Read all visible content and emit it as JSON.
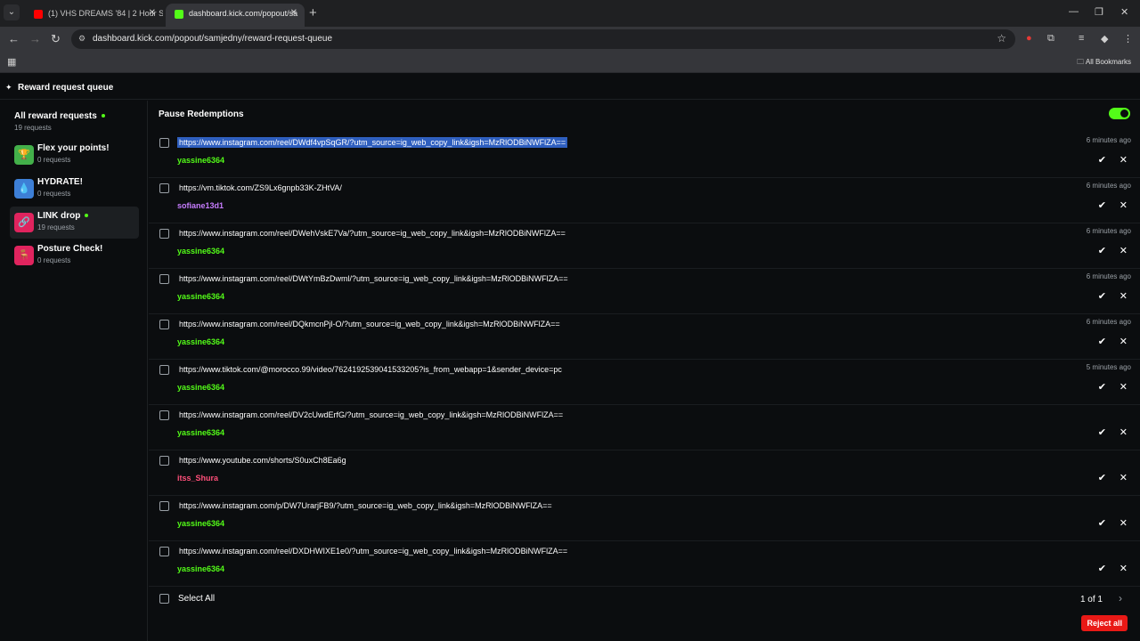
{
  "browser": {
    "tabs": [
      {
        "title": "(1) VHS DREAMS '84 | 2 Hour Sy",
        "active": false
      },
      {
        "title": "dashboard.kick.com/popout/sa",
        "active": true
      }
    ],
    "url": "dashboard.kick.com/popout/samjedny/reward-request-queue",
    "all_bookmarks": "All Bookmarks"
  },
  "page": {
    "title": "Reward request queue"
  },
  "sidebar": {
    "all": {
      "label": "All reward requests",
      "count": "19 requests"
    },
    "items": [
      {
        "label": "Flex your points!",
        "count": "0 requests",
        "color": "#43b04a",
        "icon": "trophy-icon",
        "glyph": "🏆"
      },
      {
        "label": "HYDRATE!",
        "count": "0 requests",
        "color": "#3d7fd6",
        "icon": "water-icon",
        "glyph": "💧"
      },
      {
        "label": "LINK drop",
        "count": "19 requests",
        "color": "#e0245e",
        "icon": "link-icon",
        "glyph": "🔗"
      },
      {
        "label": "Posture Check!",
        "count": "0 requests",
        "color": "#e0245e",
        "icon": "posture-icon",
        "glyph": "🪑"
      }
    ]
  },
  "main": {
    "pause_label": "Pause Redemptions",
    "select_all": "Select All",
    "pager": "1 of 1",
    "reject_all": "Reject all"
  },
  "requests": [
    {
      "link": "https://www.instagram.com/reel/DWdf4vpSqGR/?utm_source=ig_web_copy_link&igsh=MzRlODBiNWFlZA==",
      "user": "yassine6364",
      "user_color": "#53fc18",
      "time": "6 minutes ago"
    },
    {
      "link": "https://vm.tiktok.com/ZS9Lx6gnpb33K-ZHtVA/",
      "user": "sofiane13d1",
      "user_color": "#c77dff",
      "time": "6 minutes ago"
    },
    {
      "link": "https://www.instagram.com/reel/DWehVskE7Va/?utm_source=ig_web_copy_link&igsh=MzRlODBiNWFlZA==",
      "user": "yassine6364",
      "user_color": "#53fc18",
      "time": "6 minutes ago"
    },
    {
      "link": "https://www.instagram.com/reel/DWtYmBzDwml/?utm_source=ig_web_copy_link&igsh=MzRlODBiNWFlZA==",
      "user": "yassine6364",
      "user_color": "#53fc18",
      "time": "6 minutes ago"
    },
    {
      "link": "https://www.instagram.com/reel/DQkmcnPjl-O/?utm_source=ig_web_copy_link&igsh=MzRlODBiNWFlZA==",
      "user": "yassine6364",
      "user_color": "#53fc18",
      "time": "6 minutes ago"
    },
    {
      "link": "https://www.tiktok.com/@morocco.99/video/7624192539041533205?is_from_webapp=1&sender_device=pc",
      "user": "yassine6364",
      "user_color": "#53fc18",
      "time": "5 minutes ago"
    },
    {
      "link": "https://www.instagram.com/reel/DV2cUwdErfG/?utm_source=ig_web_copy_link&igsh=MzRlODBiNWFlZA==",
      "user": "yassine6364",
      "user_color": "#53fc18",
      "time": ""
    },
    {
      "link": "https://www.youtube.com/shorts/S0uxCh8Ea6g",
      "user": "itss_Shura",
      "user_color": "#ff4f7a",
      "time": ""
    },
    {
      "link": "https://www.instagram.com/p/DW7UrarjFB9/?utm_source=ig_web_copy_link&igsh=MzRlODBiNWFlZA==",
      "user": "yassine6364",
      "user_color": "#53fc18",
      "time": ""
    },
    {
      "link": "https://www.instagram.com/reel/DXDHWIXE1e0/?utm_source=ig_web_copy_link&igsh=MzRlODBiNWFlZA==",
      "user": "yassine6364",
      "user_color": "#53fc18",
      "time": ""
    }
  ]
}
